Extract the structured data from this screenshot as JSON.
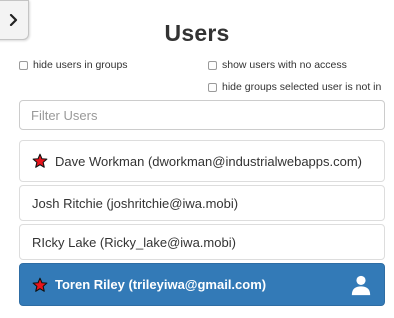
{
  "header": {
    "title": "Users",
    "collapse_icon": "chevron-right-icon"
  },
  "options": {
    "hide_in_groups": {
      "label": "hide users in groups",
      "checked": false
    },
    "show_no_access": {
      "label": "show users with no access",
      "checked": false
    },
    "hide_groups_not_in": {
      "label": "hide groups selected user is not in",
      "checked": false
    }
  },
  "filter": {
    "placeholder": "Filter Users",
    "value": ""
  },
  "users": [
    {
      "label": "Dave Workman (dworkman@industrialwebapps.com)",
      "starred": true,
      "selected": false
    },
    {
      "label": "Josh Ritchie (joshritchie@iwa.mobi)",
      "starred": false,
      "selected": false
    },
    {
      "label": "RIcky Lake (Ricky_lake@iwa.mobi)",
      "starred": false,
      "selected": false
    },
    {
      "label": "Toren Riley (trileyiwa@gmail.com)",
      "starred": true,
      "selected": true,
      "icon": "user-icon"
    }
  ],
  "colors": {
    "selected_background": "#337ab7",
    "star_fill": "#e8141c",
    "star_outline": "#111111"
  }
}
